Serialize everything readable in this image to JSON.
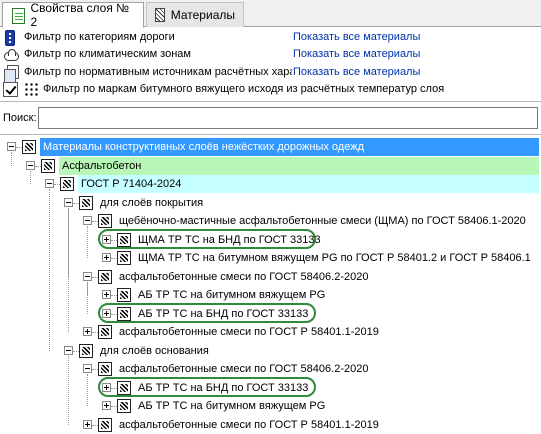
{
  "tabs": [
    {
      "label": "Свойства слоя № 2"
    },
    {
      "label": "Материалы"
    }
  ],
  "filters": [
    {
      "label": "Фильтр по категориям дороги",
      "link": "Показать все материалы"
    },
    {
      "label": "Фильтр по климатическим зонам",
      "link": "Показать все материалы"
    },
    {
      "label": "Фильтр по нормативным источникам расчётных харак",
      "link": "Показать все материалы"
    },
    {
      "label": "Фильтр по маркам битумного вяжущего исходя из расчётных температур слоя",
      "checked": true
    }
  ],
  "search": {
    "label": "Поиск:",
    "value": ""
  },
  "tree": [
    {
      "label": "Материалы конструктивных слоёв нежёстких дорожных одежд",
      "level": 0,
      "state": "expanded",
      "highlight": "#3399ff"
    },
    {
      "label": "Асфальтобетон",
      "level": 1,
      "state": "expanded",
      "highlight": "#b8f7b8"
    },
    {
      "label": "ГОСТ Р 71404-2024",
      "level": 2,
      "state": "expanded",
      "highlight": "#c6ffff"
    },
    {
      "label": "для слоёв покрытия",
      "level": 3,
      "state": "expanded"
    },
    {
      "label": "щебёночно-мастичные асфальтобетонные смеси (ЩМА) по ГОСТ 58406.1-2020",
      "level": 4,
      "state": "expanded"
    },
    {
      "label": "ЩМА ТР ТС на БНД по ГОСТ 33133",
      "level": 5,
      "state": "collapsed",
      "circled": true
    },
    {
      "label": "ЩМА ТР ТС на битумном вяжущем PG по ГОСТ Р 58401.2 и ГОСТ Р 58406.1",
      "level": 5,
      "state": "collapsed"
    },
    {
      "label": "асфальтобетонные смеси по ГОСТ 58406.2-2020",
      "level": 4,
      "state": "expanded"
    },
    {
      "label": "АБ ТР ТС на битумном вяжущем PG",
      "level": 5,
      "state": "collapsed"
    },
    {
      "label": "АБ ТР ТС на БНД по ГОСТ 33133",
      "level": 5,
      "state": "collapsed",
      "circled": true
    },
    {
      "label": "асфальтобетонные смеси по ГОСТ Р 58401.1-2019",
      "level": 4,
      "state": "collapsed"
    },
    {
      "label": "для слоёв основания",
      "level": 3,
      "state": "expanded"
    },
    {
      "label": "асфальтобетонные смеси по ГОСТ 58406.2-2020",
      "level": 4,
      "state": "expanded"
    },
    {
      "label": "АБ ТР ТС на БНД по ГОСТ 33133",
      "level": 5,
      "state": "collapsed",
      "circled": true
    },
    {
      "label": "АБ ТР ТС на битумном вяжущем PG",
      "level": 5,
      "state": "collapsed"
    },
    {
      "label": "асфальтобетонные смеси по ГОСТ Р 58401.1-2019",
      "level": 4,
      "state": "collapsed"
    }
  ],
  "colors": {
    "ring": "#2e8b3a",
    "link": "#0033aa"
  }
}
